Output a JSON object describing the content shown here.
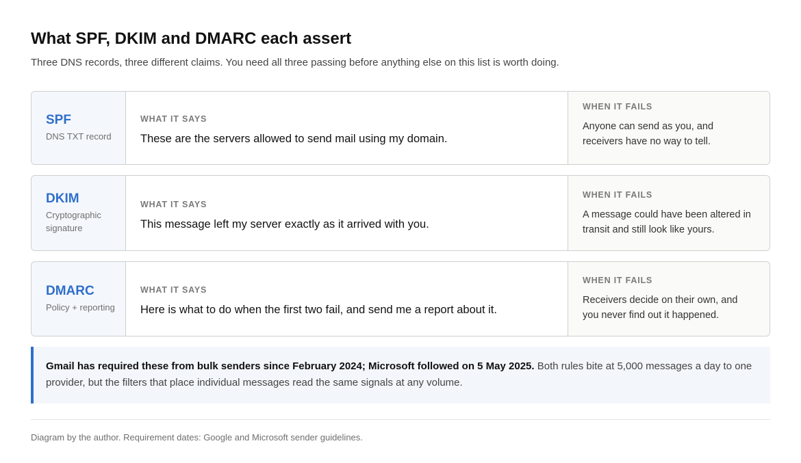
{
  "header": {
    "title": "What SPF, DKIM and DMARC each assert",
    "subtitle": "Three DNS records, three different claims. You need all three passing before anything else on this list is worth doing."
  },
  "labels": {
    "says": "WHAT IT SAYS",
    "fails": "WHEN IT FAILS"
  },
  "records": [
    {
      "name": "SPF",
      "kind": "DNS TXT record",
      "says": "These are the servers allowed to send mail using my domain.",
      "fails": "Anyone can send as you, and receivers have no way to tell."
    },
    {
      "name": "DKIM",
      "kind": "Cryptographic signature",
      "says": "This message left my server exactly as it arrived with you.",
      "fails": "A message could have been altered in transit and still look like yours."
    },
    {
      "name": "DMARC",
      "kind": "Policy + reporting",
      "says": "Here is what to do when the first two fail, and send me a report about it.",
      "fails": "Receivers decide on their own, and you never find out it happened."
    }
  ],
  "callout": {
    "strong": "Gmail has required these from bulk senders since February 2024; Microsoft followed on 5 May 2025.",
    "rest": " Both rules bite at 5,000 messages a day to one provider, but the filters that place individual messages read the same signals at any volume."
  },
  "footnote": "Diagram by the author. Requirement dates: Google and Microsoft sender guidelines.",
  "colors": {
    "accent": "#2f6fcb",
    "name_panel": "#f4f7fc",
    "callout_bg": "#f3f6fb"
  }
}
